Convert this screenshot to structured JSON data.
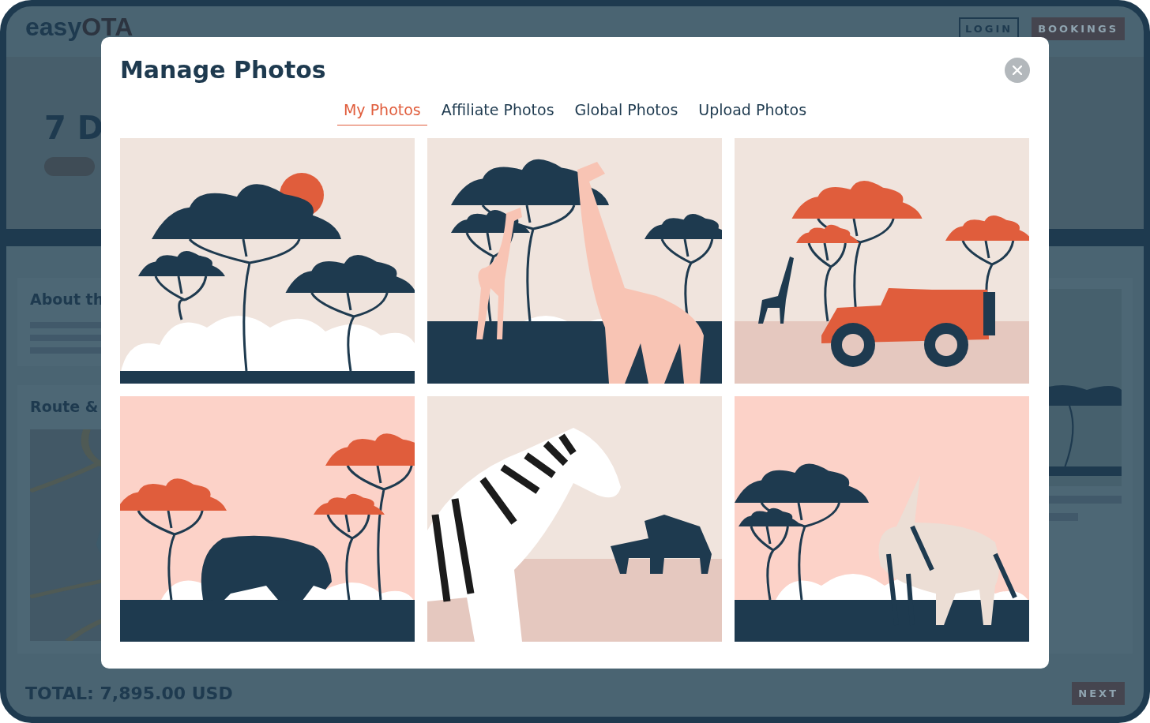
{
  "header": {
    "logo_light": "easy",
    "logo_bold": "OTA",
    "buttons": [
      {
        "label": "LOGIN",
        "kind": "outline"
      },
      {
        "label": "BOOKINGS",
        "kind": "filled"
      }
    ]
  },
  "hero": {
    "title": "7 D"
  },
  "sections": [
    {
      "title": "About th",
      "kind": "text"
    },
    {
      "title": "Route &",
      "kind": "map"
    }
  ],
  "footer": {
    "total": "TOTAL: 7,895.00 USD",
    "next": "NEXT"
  },
  "modal": {
    "title": "Manage Photos",
    "tabs": [
      {
        "label": "My Photos",
        "selected": true
      },
      {
        "label": "Affiliate Photos",
        "selected": false
      },
      {
        "label": "Global Photos",
        "selected": false
      },
      {
        "label": "Upload Photos",
        "selected": false
      }
    ],
    "photos": [
      {
        "kind": "trees"
      },
      {
        "kind": "giraffes"
      },
      {
        "kind": "jeep"
      },
      {
        "kind": "hippo"
      },
      {
        "kind": "zebras"
      },
      {
        "kind": "oryx"
      }
    ]
  }
}
